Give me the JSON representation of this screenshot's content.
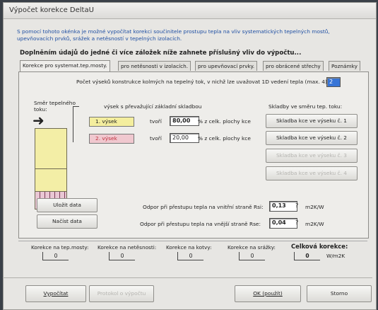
{
  "window": {
    "title": "Výpočet korekce DeltaU"
  },
  "description": "S pomocí tohoto okénka je možné vypočítat korekci součinitele prostupu tepla na vliv systematických tepelných mostů, upevňovacích prvků, srážek a netěsností v tepelných izolacích.",
  "instruction": "Doplněním údajů do jedné či více záložek níže zahnete příslušný vliv do výpočtu...",
  "tabs": [
    {
      "label": "Korekce pro systemat.tep.mosty."
    },
    {
      "label": "pro netěsnosti v izolacích."
    },
    {
      "label": "pro upevňovací prvky."
    },
    {
      "label": "pro obrácené střechy"
    },
    {
      "label": "Poznámky"
    }
  ],
  "panel": {
    "count_label": "Počet výseků konstrukce kolmých na tepelný tok, v nichž lze uvažovat 1D vedení tepla (max. 4):",
    "count_value": "2",
    "flow_label": "Směr tepelného toku:",
    "main_label": "výsek s převažující základní skladbou",
    "sections": [
      {
        "name": "1. výsek",
        "word": "tvoří",
        "value": "80,00",
        "unit": "% z celk. plochy kce",
        "color": "#f4ee9e"
      },
      {
        "name": "2. výsek",
        "word": "tvoří",
        "value": "20,00",
        "unit": "% z celk. plochy kce",
        "color": "#f0c8cf"
      }
    ],
    "skladby_label": "Skladby ve směru tep. toku:",
    "skladby_buttons": [
      "Skladba kce ve výseku č. 1",
      "Skladba kce ve výseku č. 2",
      "Skladba kce ve výseku č. 3",
      "Skladba kce ve výseku č. 4"
    ],
    "save_label": "Uložit data",
    "load_label": "Načíst data",
    "rsi_label": "Odpor při přestupu tepla na vnitřní straně  Rsi:",
    "rsi_value": "0,13",
    "rse_label": "Odpor při přestupu tepla na vnější straně  Rse:",
    "rse_value": "0,04",
    "resistance_unit": "m2K/W"
  },
  "corrections": {
    "items": [
      {
        "label": "Korekce na tep.mosty:",
        "value": "0"
      },
      {
        "label": "Korekce na netěsnosti:",
        "value": "0"
      },
      {
        "label": "Korekce na kotvy:",
        "value": "0"
      },
      {
        "label": "Korekce na srážky:",
        "value": "0"
      }
    ],
    "total_label": "Celková korekce:",
    "total_value": "0",
    "total_unit": "W/m2K"
  },
  "footer": {
    "compute_label": "Vypočítat",
    "protocol_label": "Protokol o výpočtu",
    "ok_label": "OK (použít)",
    "cancel_label": "Storno"
  }
}
